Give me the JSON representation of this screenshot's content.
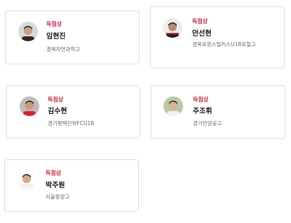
{
  "awards": [
    {
      "award": "득점상",
      "name": "임현진",
      "school": "경북자연과학고",
      "jersey_color": "#2a2a2a",
      "bg_color": "#d9d9d9"
    },
    {
      "award": "득점상",
      "name": "안선현",
      "school": "경북포항스틸러스U18포철고",
      "jersey_color": "#222222",
      "bg_color": "#ececec"
    },
    {
      "award": "득점상",
      "name": "김수현",
      "school": "경기평택진위FCU18",
      "jersey_color": "#d8232a",
      "bg_color": "#bcbcbc"
    },
    {
      "award": "득점상",
      "name": "주조휘",
      "school": "경기안양공고",
      "jersey_color": "#f2f2f2",
      "bg_color": "#b9c9a8"
    },
    {
      "award": "득점상",
      "name": "박주원",
      "school": "서울중앙고",
      "jersey_color": "#f5f5f5",
      "bg_color": "#ffffff"
    }
  ],
  "colors": {
    "award_red": "#d01f3c",
    "border": "#d9dde3"
  }
}
